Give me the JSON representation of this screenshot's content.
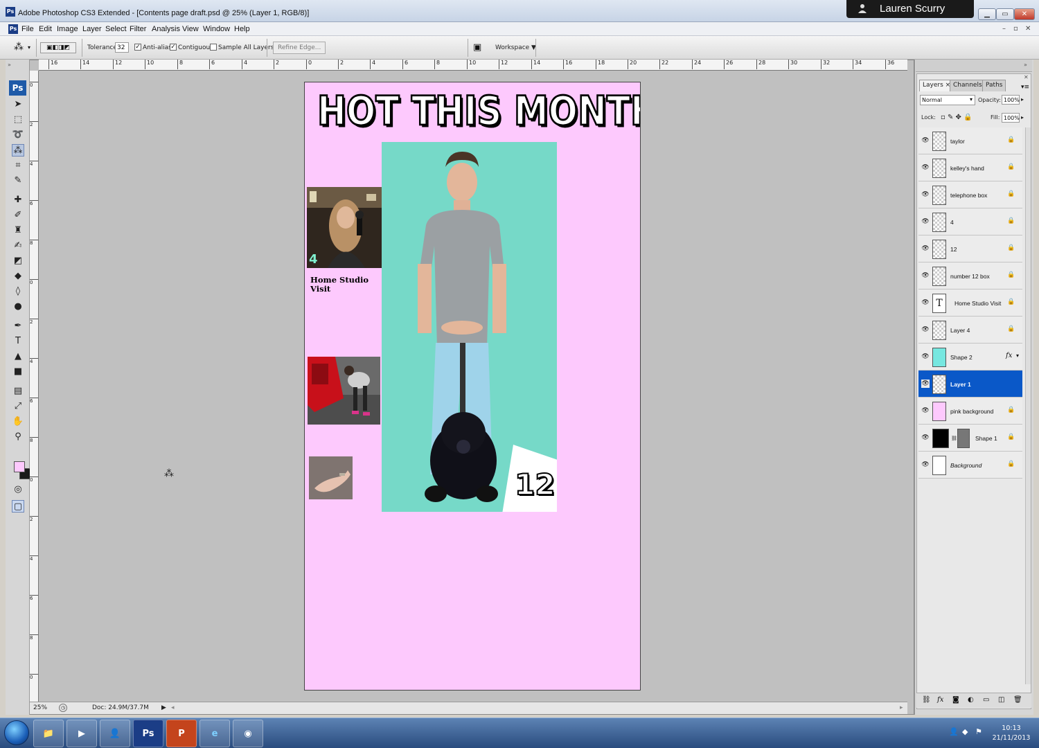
{
  "window": {
    "app_icon": "Ps",
    "title": "Adobe Photoshop CS3 Extended - [Contents page draft.psd @ 25% (Layer 1, RGB/8)]",
    "user_name": "Lauren Scurry",
    "controls": [
      "minimize-icon",
      "maximize-icon",
      "close-icon"
    ]
  },
  "menu": {
    "app_icon": "Ps",
    "items": [
      "File",
      "Edit",
      "Image",
      "Layer",
      "Select",
      "Filter",
      "Analysis",
      "View",
      "Window",
      "Help"
    ]
  },
  "options": {
    "tolerance_label": "Tolerance:",
    "tolerance_value": "32",
    "anti_alias_label": "Anti-alias",
    "anti_alias_checked": true,
    "contiguous_label": "Contiguous",
    "contiguous_checked": true,
    "sample_all_label": "Sample All Layers",
    "sample_all_checked": false,
    "refine_edge_label": "Refine Edge...",
    "workspace_label": "Workspace ▼"
  },
  "toolbox": {
    "badge": "Ps",
    "active_tool": "magic-wand-tool",
    "foreground_color": "#fdc9fd",
    "background_color": "#1a1a1a"
  },
  "rulers": {
    "horizontal": [
      "16",
      "14",
      "12",
      "10",
      "8",
      "6",
      "4",
      "2",
      "0",
      "2",
      "4",
      "6",
      "8",
      "10",
      "12",
      "14",
      "16",
      "18",
      "20",
      "22",
      "24",
      "26",
      "28",
      "30",
      "32",
      "34",
      "36"
    ],
    "vertical": [
      "0",
      "2",
      "4",
      "6",
      "8",
      "0",
      "2",
      "4",
      "6",
      "8",
      "0",
      "2",
      "4",
      "6",
      "8",
      "0"
    ]
  },
  "document": {
    "background_color": "#fdc9fd",
    "headline": "HOT THIS MONTH...",
    "main_panel_color": "#76d9c8",
    "feature_number": "12",
    "thumb1_number": "4",
    "thumb1_caption": "Home Studio Visit"
  },
  "status": {
    "zoom": "25%",
    "doc_size": "Doc: 24.9M/37.7M"
  },
  "layers_panel": {
    "tabs": [
      "Layers ×",
      "Channels",
      "Paths"
    ],
    "blend_mode": "Normal",
    "opacity_label": "Opacity:",
    "opacity_value": "100%",
    "lock_label": "Lock:",
    "fill_label": "Fill:",
    "fill_value": "100%",
    "layers": [
      {
        "name": "taylor",
        "locked": true,
        "selected": false
      },
      {
        "name": "kelley's hand",
        "locked": true,
        "selected": false
      },
      {
        "name": "telephone box",
        "locked": true,
        "selected": false
      },
      {
        "name": "4",
        "locked": true,
        "selected": false
      },
      {
        "name": "12",
        "locked": true,
        "selected": false
      },
      {
        "name": "number 12 box",
        "locked": true,
        "selected": false
      },
      {
        "name": "Home Studio Visit",
        "locked": true,
        "selected": false,
        "type": "text"
      },
      {
        "name": "Layer 4",
        "locked": true,
        "selected": false
      },
      {
        "name": "Shape 2",
        "locked": false,
        "selected": false,
        "fx": true
      },
      {
        "name": "Layer 1",
        "locked": false,
        "selected": true
      },
      {
        "name": "pink background",
        "locked": true,
        "selected": false
      },
      {
        "name": "Shape 1",
        "locked": true,
        "selected": false
      },
      {
        "name": "Background",
        "locked": true,
        "selected": false
      }
    ]
  },
  "taskbar": {
    "time": "10:13",
    "date": "21/11/2013",
    "ps_button": "Ps",
    "ppt_button": "P"
  }
}
